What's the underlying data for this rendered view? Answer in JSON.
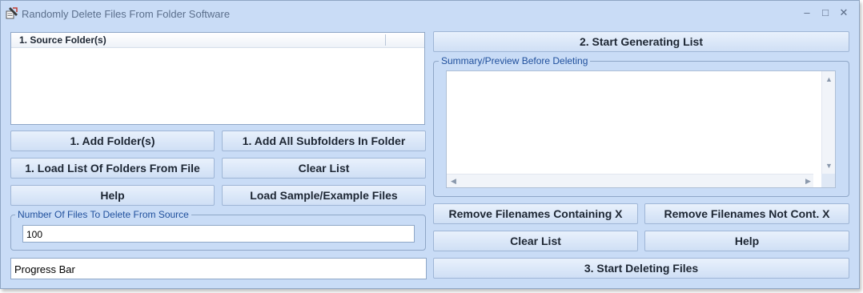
{
  "window": {
    "title": "Randomly Delete Files From Folder Software",
    "controls": {
      "minimize": "–",
      "maximize": "□",
      "close": "✕"
    }
  },
  "left": {
    "source_list_header": "1. Source Folder(s)",
    "buttons": {
      "add_folders": "1. Add Folder(s)",
      "add_subfolders": "1. Add All Subfolders In Folder",
      "load_list": "1. Load List Of Folders From File",
      "clear_list": "Clear List",
      "help": "Help",
      "load_sample": "Load Sample/Example Files"
    },
    "number_group_label": "Number Of Files To Delete From Source",
    "number_value": "100",
    "progress_bar_label": "Progress Bar"
  },
  "right": {
    "start_generating": "2. Start Generating List",
    "summary_group_label": "Summary/Preview Before Deleting",
    "buttons": {
      "remove_containing": "Remove Filenames Containing X",
      "remove_not_containing": "Remove Filenames Not Cont. X",
      "clear_list": "Clear List",
      "help": "Help",
      "start_deleting": "3. Start Deleting Files"
    }
  },
  "colors": {
    "window_bg": "#c9dcf6",
    "group_label": "#1f4f9c",
    "border": "#8fa7c7"
  },
  "icons": [
    "app-icon",
    "minimize-icon",
    "maximize-icon",
    "close-icon",
    "scroll-up-icon",
    "scroll-down-icon",
    "scroll-left-icon",
    "scroll-right-icon"
  ]
}
